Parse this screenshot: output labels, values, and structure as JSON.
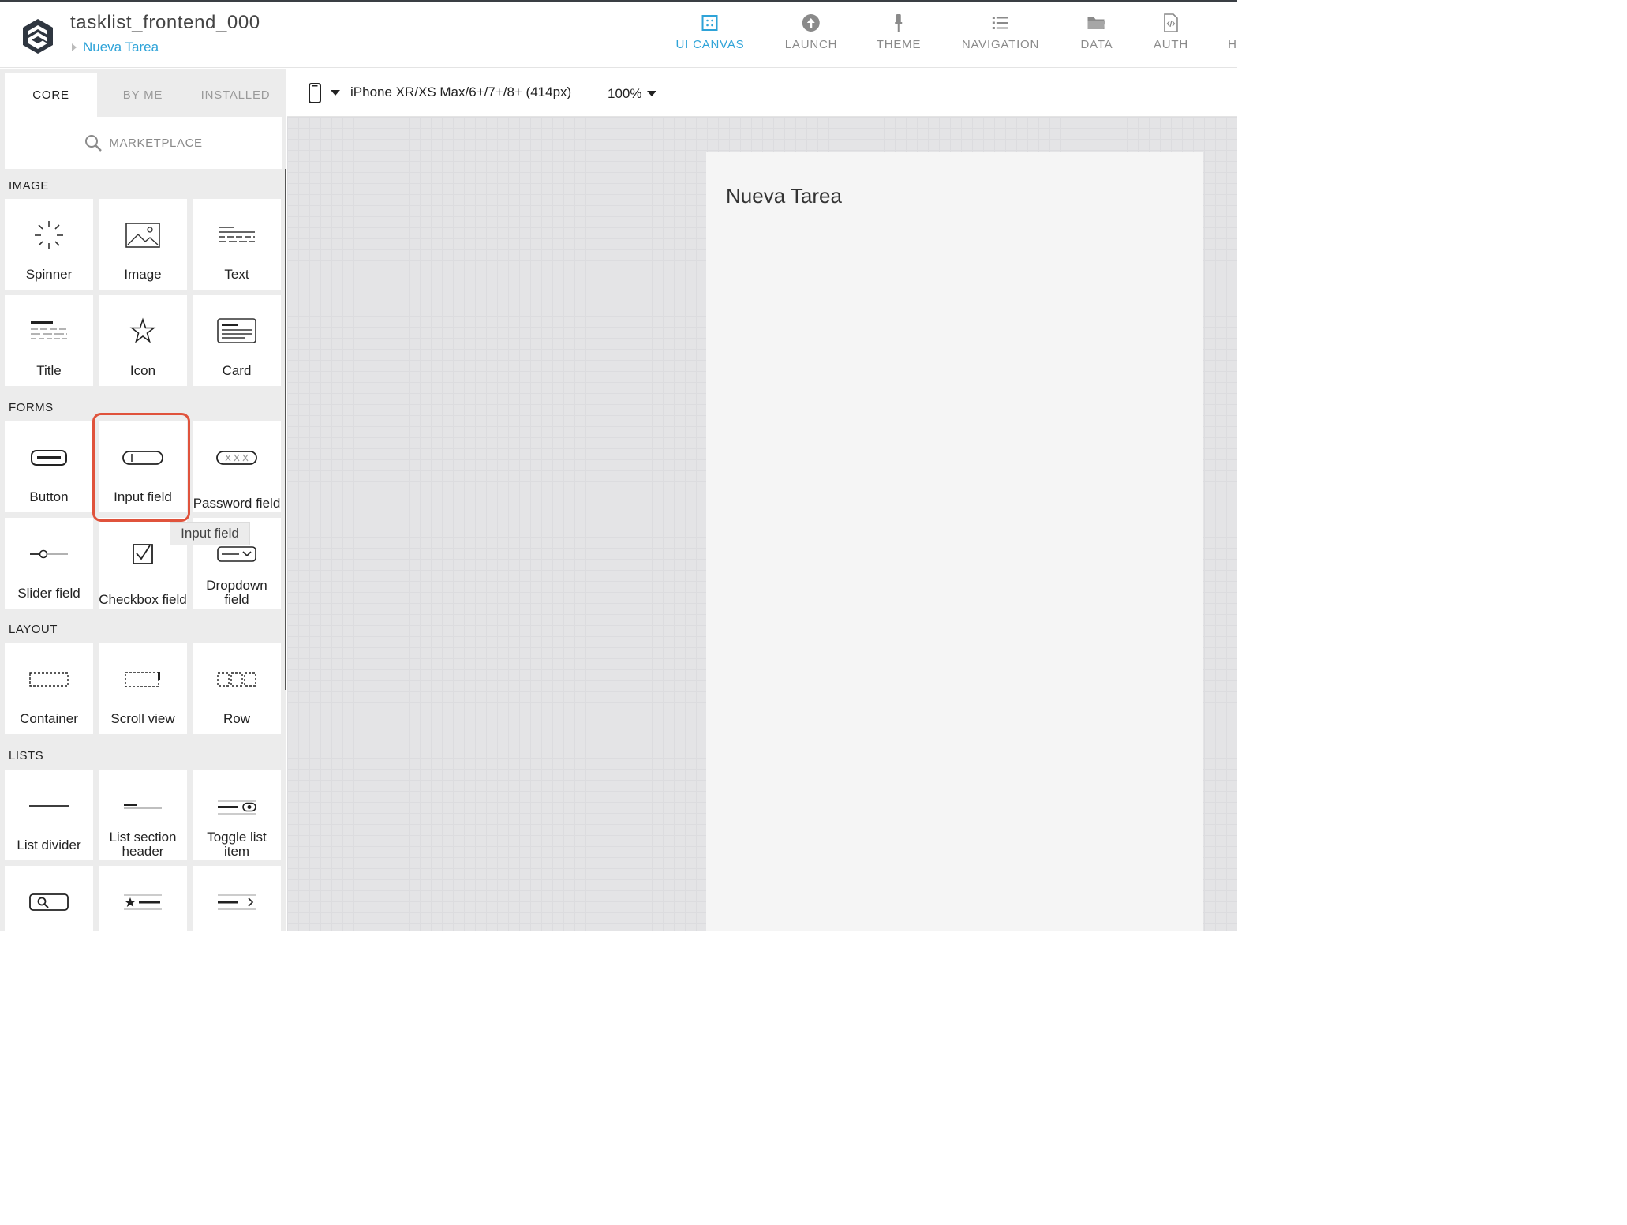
{
  "header": {
    "app_title": "tasklist_frontend_000",
    "breadcrumb": "Nueva Tarea",
    "nav": [
      {
        "label": "UI CANVAS",
        "icon": "ui-canvas-icon",
        "active": true
      },
      {
        "label": "LAUNCH",
        "icon": "launch-icon"
      },
      {
        "label": "THEME",
        "icon": "theme-icon"
      },
      {
        "label": "NAVIGATION",
        "icon": "navigation-icon"
      },
      {
        "label": "DATA",
        "icon": "data-icon"
      },
      {
        "label": "AUTH",
        "icon": "auth-icon"
      },
      {
        "label": "H",
        "icon": "more-icon"
      }
    ],
    "accent_color": "#2ea3d8"
  },
  "sidebar": {
    "tabs": [
      "CORE",
      "BY ME",
      "INSTALLED"
    ],
    "marketplace": "MARKETPLACE",
    "sections": {
      "image": "IMAGE",
      "forms": "FORMS",
      "layout": "LAYOUT",
      "lists": "LISTS"
    },
    "components": {
      "spinner": "Spinner",
      "image": "Image",
      "text": "Text",
      "title": "Title",
      "icon": "Icon",
      "card": "Card",
      "button": "Button",
      "input_field": "Input field",
      "password_field": "Password field",
      "slider_field": "Slider field",
      "checkbox_field": "Checkbox field",
      "dropdown_field": "Dropdown field",
      "container": "Container",
      "scroll_view": "Scroll view",
      "row": "Row",
      "list_divider": "List divider",
      "list_section_header": "List section header",
      "toggle_list_item": "Toggle list item"
    },
    "tooltip": "Input field",
    "highlight_color": "#e0533c"
  },
  "toolbar": {
    "device": "iPhone XR/XS Max/6+/7+/8+ (414px)",
    "zoom": "100%"
  },
  "canvas": {
    "screen_title": "Nueva Tarea"
  }
}
